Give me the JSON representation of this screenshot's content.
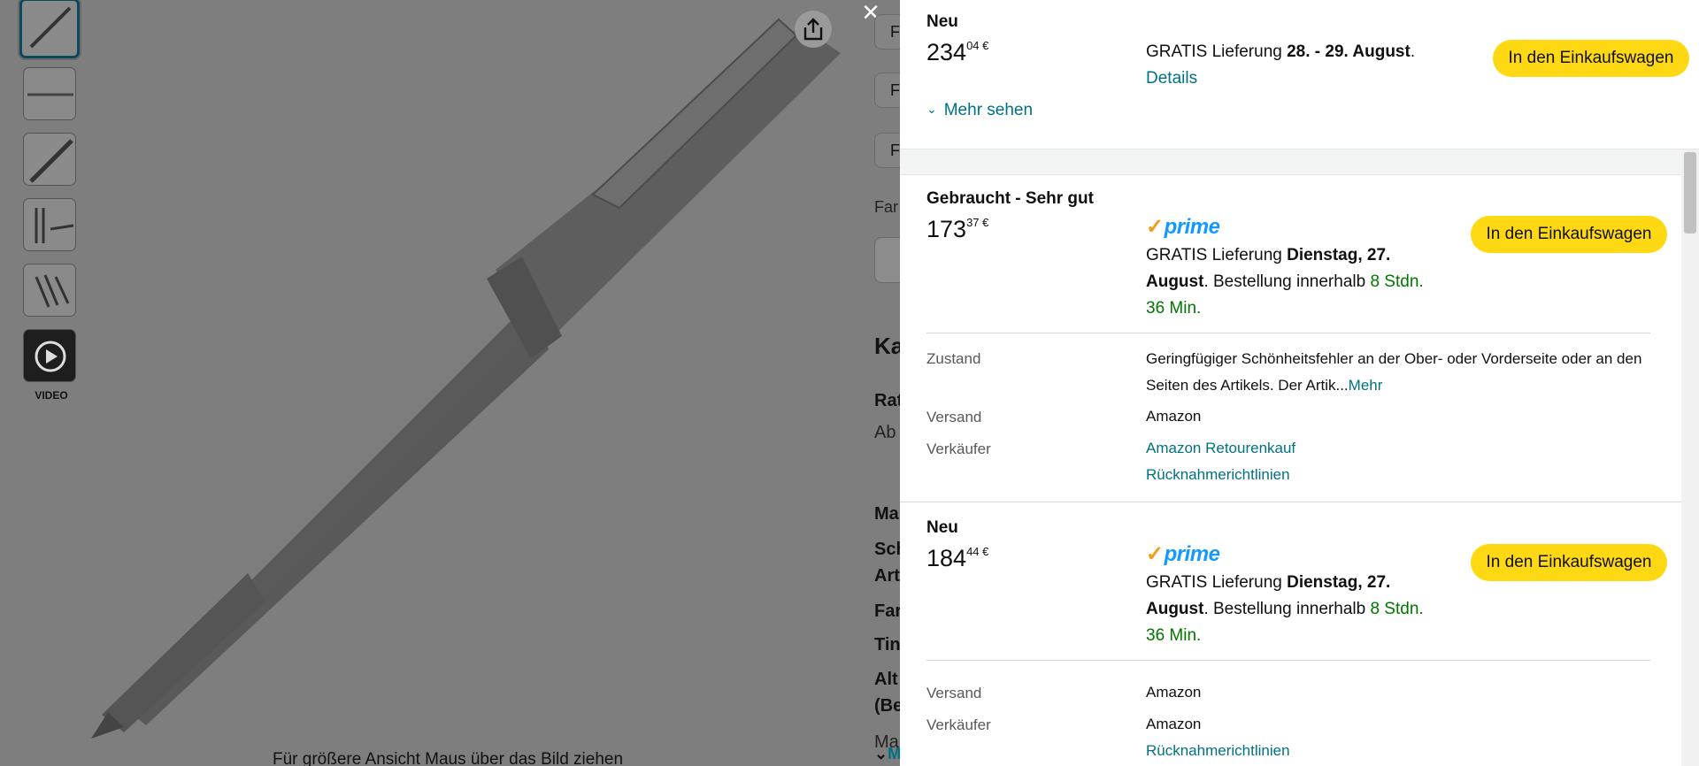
{
  "gallery": {
    "video_label": "VIDEO",
    "hover_hint": "Für größere Ansicht Maus über das Bild ziehen"
  },
  "peek": {
    "box_letter": "F",
    "labels": [
      "Far",
      "Ka",
      "Rat",
      "Ab",
      "Ma",
      "Sch",
      "Art",
      "Far",
      "Tin",
      "Alt",
      "(Be",
      "Ma"
    ],
    "more": "M"
  },
  "offers": [
    {
      "condition": "Neu",
      "price_main": "234",
      "price_sup": "04 €",
      "delivery_prefix": "GRATIS Lieferung ",
      "delivery_date": "28. - 29. August",
      "delivery_suffix": ".",
      "details_link": "Details",
      "more_link": "Mehr sehen",
      "cart_label": "In den Einkaufswagen"
    },
    {
      "condition": "Gebraucht - Sehr gut",
      "price_main": "173",
      "price_sup": "37 €",
      "prime": "prime",
      "delivery_prefix": "GRATIS Lieferung ",
      "delivery_date": "Dienstag, 27. August",
      "delivery_mid": ". Bestellung innerhalb ",
      "delivery_time": "8 Stdn. 36 Min.",
      "cart_label": "In den Einkaufswagen",
      "zustand_label": "Zustand",
      "zustand_text": "Geringfügiger Schönheitsfehler an der Ober- oder Vorderseite oder an den Seiten des Artikels. Der Artik...",
      "zustand_more": "Mehr",
      "versand_label": "Versand",
      "versand_value": "Amazon",
      "seller_label": "Verkäufer",
      "seller_value": "Amazon Retourenkauf",
      "returns_link": "Rücknahmerichtlinien"
    },
    {
      "condition": "Neu",
      "price_main": "184",
      "price_sup": "44 €",
      "prime": "prime",
      "delivery_prefix": "GRATIS Lieferung ",
      "delivery_date": "Dienstag, 27. August",
      "delivery_mid": ". Bestellung innerhalb ",
      "delivery_time": "8 Stdn. 36 Min.",
      "cart_label": "In den Einkaufswagen",
      "versand_label": "Versand",
      "versand_value": "Amazon",
      "seller_label": "Verkäufer",
      "seller_value": "Amazon",
      "returns_link": "Rücknahmerichtlinien"
    }
  ],
  "colors": {
    "cart_button": "#ffd814",
    "link": "#007185",
    "green": "#007600",
    "prime_blue": "#1399ff",
    "prime_check": "#f29c17"
  }
}
